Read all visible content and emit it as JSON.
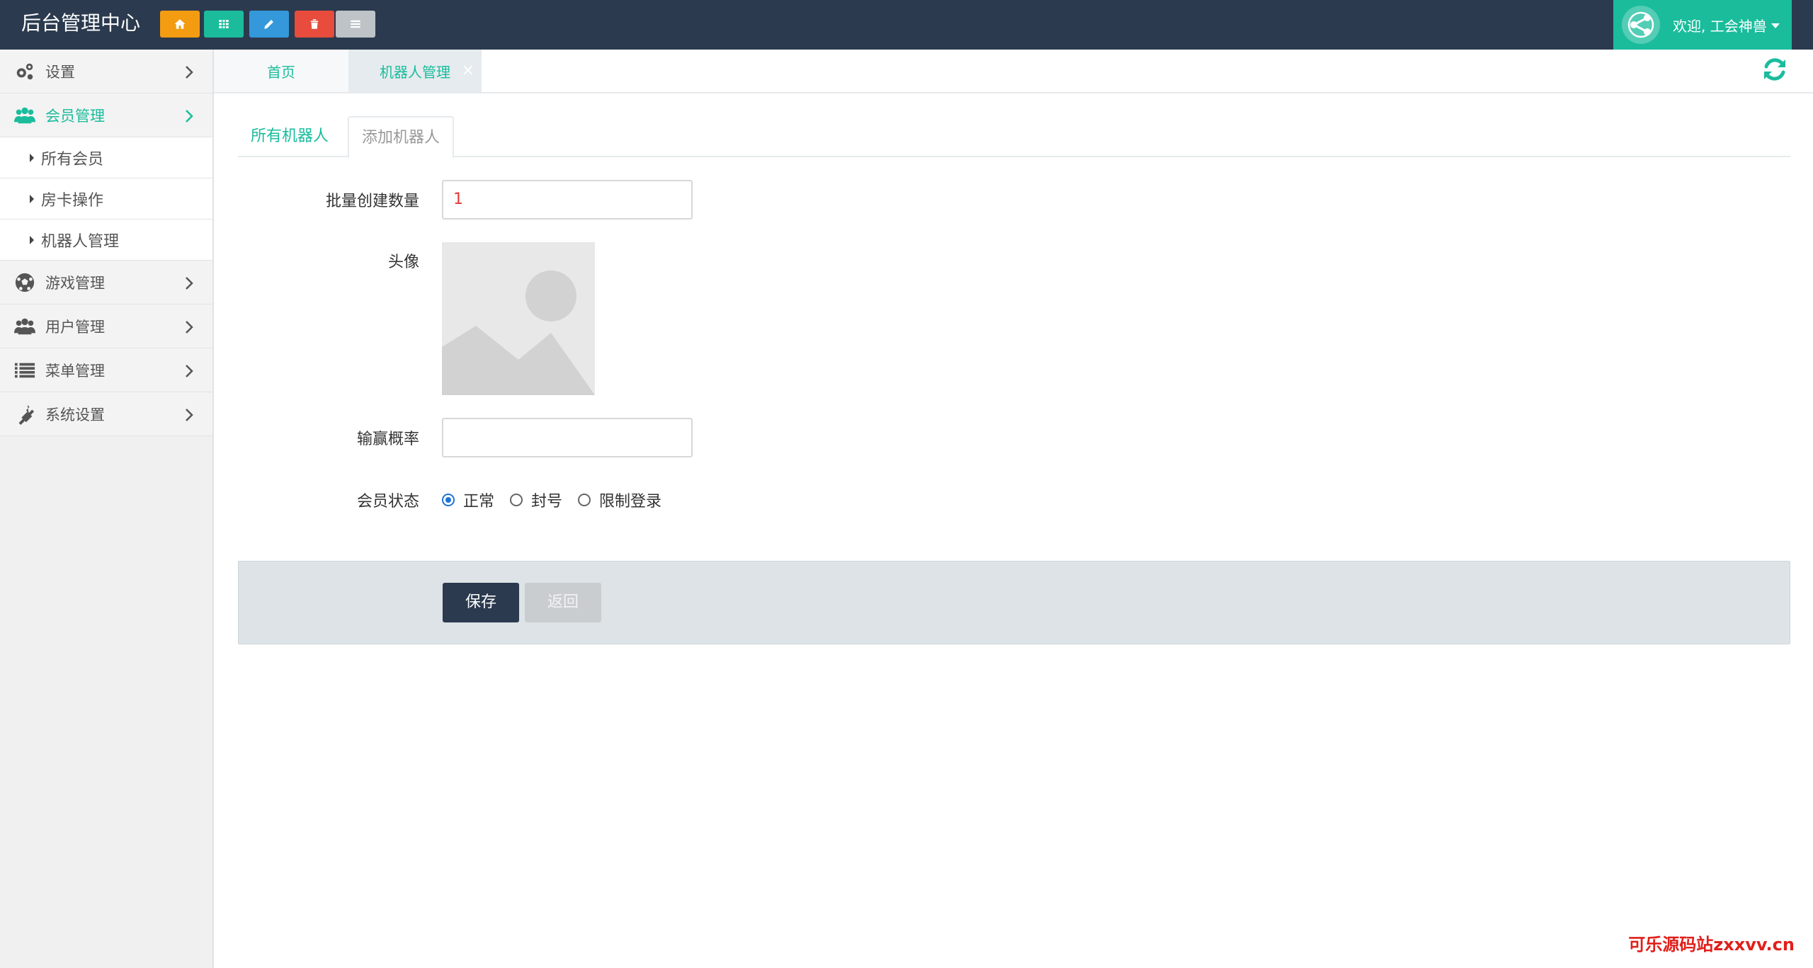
{
  "app": {
    "title": "后台管理中心"
  },
  "toolbar": {
    "buttons": [
      {
        "icon": "home-icon",
        "color": "#f39c12"
      },
      {
        "icon": "grid-icon",
        "color": "#1abc9c"
      },
      {
        "icon": "pencil-icon",
        "color": "#3498db"
      },
      {
        "icon": "trash-icon",
        "color": "#e74c3c"
      },
      {
        "icon": "list-icon",
        "color": "#bdc3c7"
      }
    ]
  },
  "user": {
    "welcome": "欢迎, 工会神兽"
  },
  "sidebar": {
    "items": [
      {
        "label": "设置",
        "icon": "gears-icon"
      },
      {
        "label": "会员管理",
        "icon": "users-icon",
        "active": true,
        "children": [
          {
            "label": "所有会员"
          },
          {
            "label": "房卡操作"
          },
          {
            "label": "机器人管理"
          }
        ]
      },
      {
        "label": "游戏管理",
        "icon": "soccer-ball-icon"
      },
      {
        "label": "用户管理",
        "icon": "users-icon"
      },
      {
        "label": "菜单管理",
        "icon": "list-icon"
      },
      {
        "label": "系统设置",
        "icon": "plug-icon"
      }
    ]
  },
  "page_tabs": [
    {
      "label": "首页"
    },
    {
      "label": "机器人管理",
      "close": "×"
    }
  ],
  "form_tabs": [
    {
      "label": "所有机器人"
    },
    {
      "label": "添加机器人"
    }
  ],
  "form": {
    "batch_count": {
      "label": "批量创建数量",
      "value": "1"
    },
    "avatar": {
      "label": "头像"
    },
    "win_rate": {
      "label": "输赢概率",
      "value": ""
    },
    "status": {
      "label": "会员状态",
      "options": [
        {
          "label": "正常",
          "checked": true
        },
        {
          "label": "封号"
        },
        {
          "label": "限制登录"
        }
      ]
    }
  },
  "actions": {
    "save": "保存",
    "back": "返回"
  },
  "watermark": "可乐源码站zxxvv.cn",
  "colors": {
    "accent": "#1abc9c",
    "header": "#2b3a4e"
  }
}
